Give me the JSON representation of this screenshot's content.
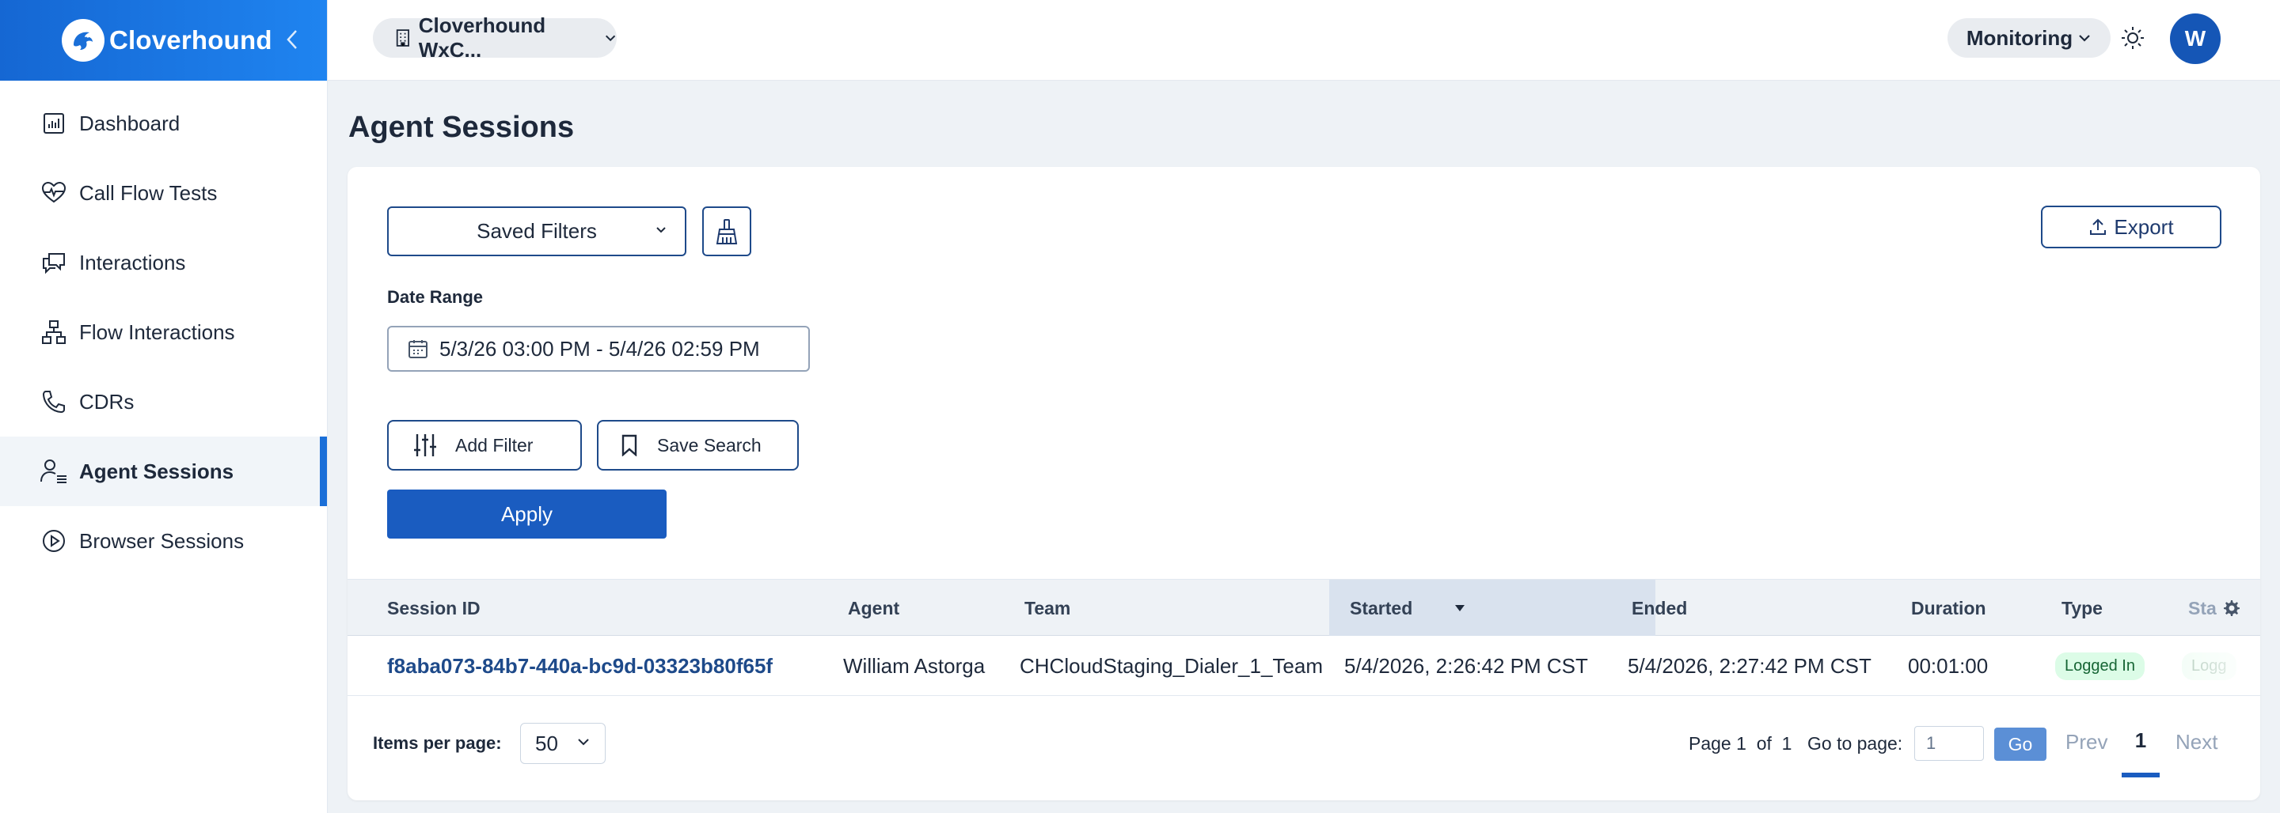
{
  "brand": {
    "name": "Cloverhound",
    "logo_icon": "cloverhound-logo-icon",
    "color": "#1a6fd8"
  },
  "sidebar": {
    "items": [
      {
        "label": "Dashboard",
        "icon": "dashboard-icon"
      },
      {
        "label": "Call Flow Tests",
        "icon": "heartbeat-icon"
      },
      {
        "label": "Interactions",
        "icon": "chat-icon"
      },
      {
        "label": "Flow Interactions",
        "icon": "flow-icon"
      },
      {
        "label": "CDRs",
        "icon": "phone-icon"
      },
      {
        "label": "Agent Sessions",
        "icon": "agent-icon",
        "active": true
      },
      {
        "label": "Browser Sessions",
        "icon": "play-circle-icon"
      }
    ]
  },
  "topbar": {
    "org": "Cloverhound WxC...",
    "mode": "Monitoring",
    "avatar_initial": "W"
  },
  "page": {
    "title": "Agent Sessions"
  },
  "filters": {
    "saved_filters_label": "Saved Filters",
    "export_label": "Export",
    "date_range_label": "Date Range",
    "date_range_value": "5/3/26 03:00 PM - 5/4/26 02:59 PM",
    "add_filter_label": "Add Filter",
    "save_search_label": "Save Search",
    "apply_label": "Apply"
  },
  "table": {
    "columns": [
      "Session ID",
      "Agent",
      "Team",
      "Started",
      "Ended",
      "Duration",
      "Type",
      "Sta"
    ],
    "sorted_column": "Started",
    "sort_direction": "descending",
    "rows": [
      {
        "session_id": "f8aba073-84b7-440a-bc9d-03323b80f65f",
        "agent": "William Astorga",
        "team": "CHCloudStaging_Dialer_1_Team",
        "started": "5/4/2026, 2:26:42 PM CST",
        "ended": "5/4/2026, 2:27:42 PM CST",
        "duration": "00:01:00",
        "type": "Logged In",
        "status": "Logg"
      }
    ]
  },
  "pagination": {
    "items_per_page_label": "Items per page:",
    "items_per_page": "50",
    "page_label": "Page",
    "current_page": "1",
    "of_label": "of",
    "total_pages": "1",
    "goto_label": "Go to page:",
    "goto_value": "1",
    "go_label": "Go",
    "prev_label": "Prev",
    "next_label": "Next"
  }
}
